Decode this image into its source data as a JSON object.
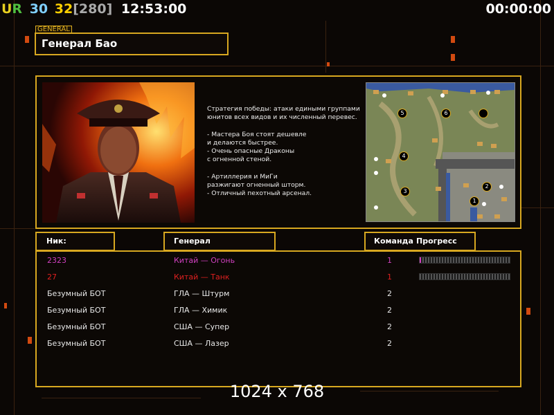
{
  "hud": {
    "ur_label": "UR",
    "fps_a": "30",
    "fps_b": "32",
    "ping": "[280]",
    "clock": "12:53:00",
    "timer": "00:00:00"
  },
  "colors": {
    "accent": "#d8a820",
    "ur_u": "#e8d020",
    "ur_r": "#50c040",
    "fps_a": "#80d0ff",
    "fps_b": "#ffd000",
    "ping": "#aaaaaa",
    "player_pink": "#d040c0",
    "player_red": "#e02020",
    "bot": "#e8e8e8"
  },
  "general": {
    "tag": "GENERAL",
    "name": "Генерал Бао",
    "description": [
      "Стратегия победы: атаки едиными группами",
      "юнитов всех видов и их численный перевес.",
      "",
      "- Мастера Боя стоят дешевле",
      "и делаются быстрее.",
      "- Очень опасные Драконы",
      "с огненной стеной.",
      "",
      "- Артиллерия и МиГи",
      "разжигают огненный шторм.",
      "- Отличный пехотный арсенал."
    ]
  },
  "map": {
    "slots": [
      "5",
      "6",
      "4",
      "3",
      "2",
      "1"
    ]
  },
  "columns": {
    "nick": "Ник:",
    "general": "Генерал",
    "team": "Команда",
    "progress": "Прогресс"
  },
  "players": [
    {
      "nick": "2323",
      "general": "Китай — Огонь",
      "team": "1",
      "color": "#d040c0",
      "has_progress": true
    },
    {
      "nick": "27",
      "general": "Китай — Танк",
      "team": "1",
      "color": "#e02020",
      "has_progress": true
    },
    {
      "nick": "Безумный БОТ",
      "general": "ГЛА — Штурм",
      "team": "2",
      "color": "#e8e8e8",
      "has_progress": false
    },
    {
      "nick": "Безумный БОТ",
      "general": "ГЛА — Химик",
      "team": "2",
      "color": "#e8e8e8",
      "has_progress": false
    },
    {
      "nick": "Безумный БОТ",
      "general": "США — Супер",
      "team": "2",
      "color": "#e8e8e8",
      "has_progress": false
    },
    {
      "nick": "Безумный БОТ",
      "general": "США — Лазер",
      "team": "2",
      "color": "#e8e8e8",
      "has_progress": false
    }
  ],
  "resolution": "1024 x 768"
}
